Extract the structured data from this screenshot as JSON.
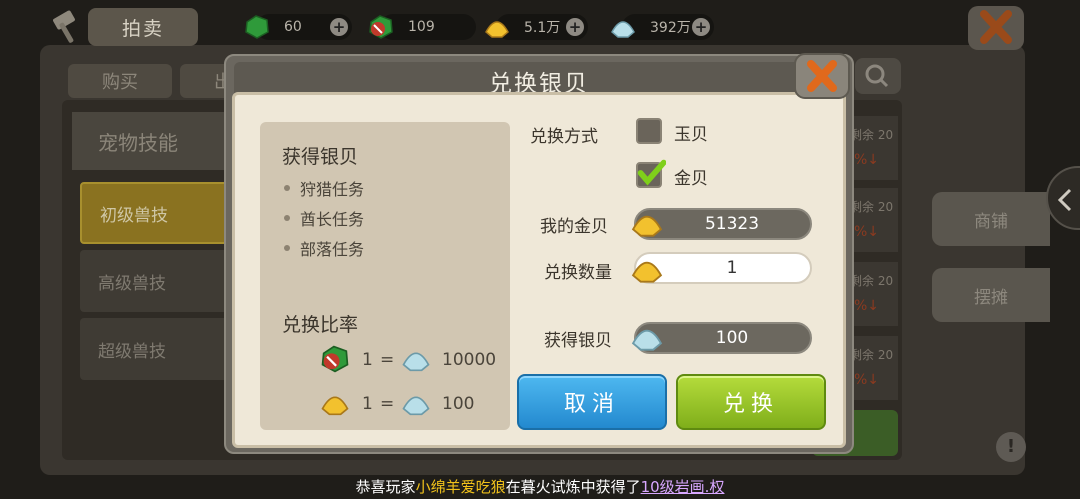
{
  "header": {
    "tab_title": "拍卖",
    "resources": [
      {
        "icon": "green-jade-icon",
        "value": "60"
      },
      {
        "icon": "no-trade-jade-icon",
        "value": "109"
      },
      {
        "icon": "gold-shell-icon",
        "value": "5.1万"
      },
      {
        "icon": "silver-shell-icon",
        "value": "392万"
      }
    ]
  },
  "background": {
    "tabs": {
      "buy": "购买",
      "sell": "出"
    },
    "category_header": "宠物技能",
    "categories": [
      "初级兽技",
      "高级兽技",
      "超级兽技"
    ],
    "row_hint": "剩余 20",
    "side_buttons": [
      "商铺",
      "摆摊"
    ]
  },
  "modal": {
    "title": "兑换银贝",
    "left": {
      "obtain_title": "获得银贝",
      "sources": [
        "狩猎任务",
        "酋长任务",
        "部落任务"
      ],
      "rate_title": "兑换比率",
      "rates": [
        {
          "from_icon": "no-trade-jade-icon",
          "lhs": "1",
          "eq": "=",
          "to_icon": "silver-shell-icon",
          "rhs": "10000"
        },
        {
          "from_icon": "gold-shell-icon",
          "lhs": "1",
          "eq": "=",
          "to_icon": "silver-shell-icon",
          "rhs": "100"
        }
      ]
    },
    "right": {
      "method_label": "兑换方式",
      "option_jade": "玉贝",
      "option_gold": "金贝",
      "selected": "金贝",
      "my_gold_label": "我的金贝",
      "my_gold_value": "51323",
      "qty_label": "兑换数量",
      "qty_value": "1",
      "gain_label": "获得银贝",
      "gain_value": "100"
    },
    "buttons": {
      "cancel": "取消",
      "confirm": "兑换"
    }
  },
  "ticker": {
    "prefix": "恭喜玩家",
    "player": "小绵羊爱吃狼",
    "middle": "在暮火试炼中获得了",
    "item": "10级岩画.权"
  }
}
